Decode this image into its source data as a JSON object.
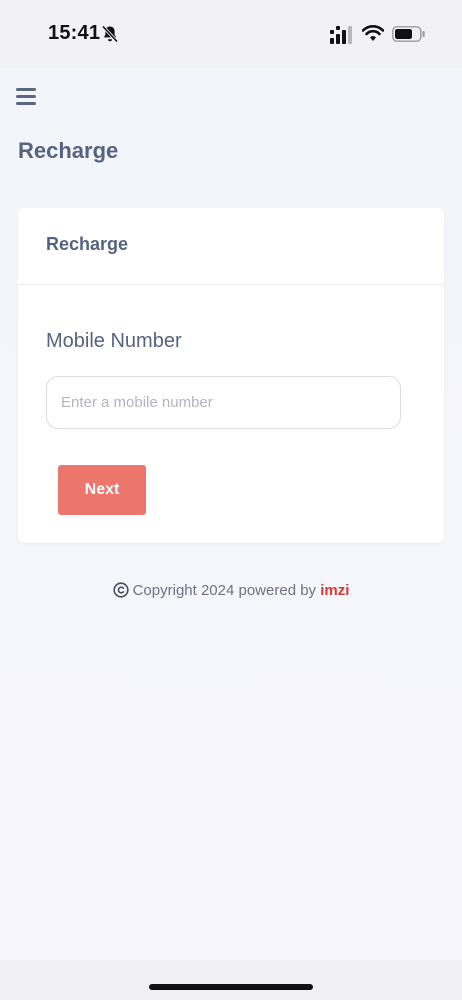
{
  "status_bar": {
    "time": "15:41",
    "icons": [
      "bell-slash-icon",
      "signal-icon",
      "wifi-icon",
      "battery-icon"
    ]
  },
  "header": {
    "menu_icon": "hamburger-menu-icon",
    "page_title": "Recharge"
  },
  "card": {
    "title": "Recharge",
    "field_label": "Mobile Number",
    "input_placeholder": "Enter a mobile number",
    "input_value": "",
    "next_label": "Next"
  },
  "footer": {
    "copyright_text": "Copyright 2024 powered by",
    "brand": "imzi"
  },
  "colors": {
    "accent_button": "#ec756c",
    "brand_red": "#d33a32",
    "heading_slate": "#566380",
    "background": "#f5f5fb"
  }
}
